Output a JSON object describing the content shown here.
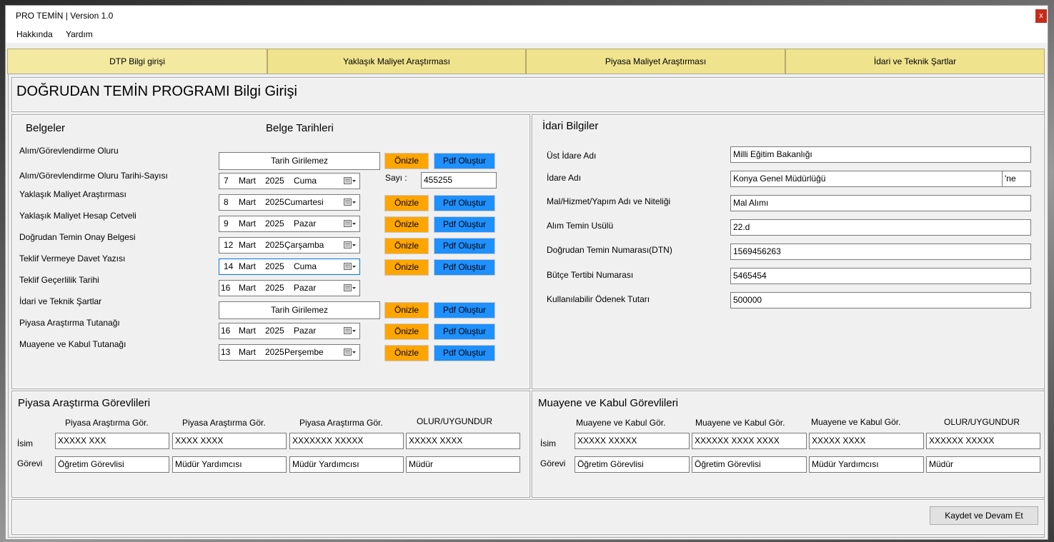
{
  "window": {
    "title": "PRO TEMİN | Version 1.0",
    "close": "x"
  },
  "menu": [
    "Hakkında",
    "Yardım"
  ],
  "tabs": [
    "DTP Bilgi girişi",
    "Yaklaşık Maliyet Araştırması",
    "Piyasa Maliyet Araştırması",
    "İdari ve Teknik Şartlar"
  ],
  "heading": "DOĞRUDAN TEMİN PROGRAMI Bilgi Girişi",
  "belgeler": {
    "title": "Belgeler",
    "dates_title": "Belge Tarihleri",
    "sayi_label": "Sayı :",
    "sayi_value": "455255",
    "preview_label": "Önizle",
    "pdf_label": "Pdf Oluştur",
    "rows": [
      {
        "label": "Alım/Görevlendirme Oluru",
        "text": "Tarih Girilemez"
      },
      {
        "label": "Alım/Görevlendirme Oluru Tarihi-Sayısı",
        "day": "7",
        "month": "Mart",
        "year": "2025",
        "weekday": "Cuma"
      },
      {
        "label": "Yaklaşık Maliyet Araştırması",
        "day": "8",
        "month": "Mart",
        "year": "2025",
        "weekday": "Cumartesi"
      },
      {
        "label": "Yaklaşık Maliyet Hesap Cetveli",
        "day": "9",
        "month": "Mart",
        "year": "2025",
        "weekday": "Pazar"
      },
      {
        "label": "Doğrudan Temin Onay Belgesi",
        "day": "12",
        "month": "Mart",
        "year": "2025",
        "weekday": "Çarşamba"
      },
      {
        "label": "Teklif Vermeye Davet Yazısı",
        "day": "14",
        "month": "Mart",
        "year": "2025",
        "weekday": "Cuma"
      },
      {
        "label": "Teklif Geçerlilik Tarihi",
        "day": "16",
        "month": "Mart",
        "year": "2025",
        "weekday": "Pazar"
      },
      {
        "label": "İdari ve Teknik Şartlar",
        "text": "Tarih Girilemez"
      },
      {
        "label": "Piyasa Araştırma Tutanağı",
        "day": "16",
        "month": "Mart",
        "year": "2025",
        "weekday": "Pazar"
      },
      {
        "label": "Muayene ve Kabul Tutanağı",
        "day": "13",
        "month": "Mart",
        "year": "2025",
        "weekday": "Perşembe"
      }
    ]
  },
  "idari": {
    "title": "İdari Bilgiler",
    "suffix": "'ne",
    "rows": [
      {
        "label": "Üst İdare Adı",
        "value": "Milli Eğitim Bakanlığı"
      },
      {
        "label": "İdare Adı",
        "value": "Konya Genel Müdürlüğü"
      },
      {
        "label": "Mal/Hizmet/Yapım Adı ve Niteliği",
        "value": "Mal Alımı"
      },
      {
        "label": "Alım Temin Usülü",
        "value": "22.d"
      },
      {
        "label": "Doğrudan Temin Numarası(DTN)",
        "value": "1569456263"
      },
      {
        "label": "Bütçe Tertibi Numarası",
        "value": "5465454"
      },
      {
        "label": "Kullanılabilir Ödenek Tutarı",
        "value": "500000"
      }
    ]
  },
  "piyasa": {
    "title": "Piyasa Araştırma Görevlileri",
    "isim_label": "İsim",
    "gorev_label": "Görevi",
    "headers": [
      "Piyasa Araştırma Gör.",
      "Piyasa Araştırma Gör.",
      "Piyasa Araştırma Gör.",
      "OLUR/UYGUNDUR"
    ],
    "names": [
      "XXXXX XXX",
      "XXXX XXXX",
      "XXXXXXX XXXXX",
      "XXXXX XXXX"
    ],
    "roles": [
      "Öğretim Görevlisi",
      "Müdür Yardımcısı",
      "Müdür Yardımcısı",
      "Müdür"
    ]
  },
  "muayene": {
    "title": "Muayene ve Kabul Görevlileri",
    "isim_label": "İsim",
    "gorev_label": "Görevi",
    "headers": [
      "Muayene ve Kabul Gör.",
      "Muayene ve Kabul Gör.",
      "Muayene ve Kabul Gör.",
      "OLUR/UYGUNDUR"
    ],
    "names": [
      "XXXXX XXXXX",
      "XXXXXX XXXX XXXX",
      "XXXXX XXXX",
      "XXXXXX XXXXX"
    ],
    "roles": [
      "Öğretim Görevlisi",
      "Öğretim Görevlisi",
      "Müdür Yardımcısı",
      "Müdür"
    ]
  },
  "footer": {
    "save_label": "Kaydet ve Devam Et"
  },
  "colors": {
    "tab": "#f0e38e",
    "preview": "#ffa500",
    "pdf": "#1e90ff",
    "close": "#c42b1c"
  }
}
